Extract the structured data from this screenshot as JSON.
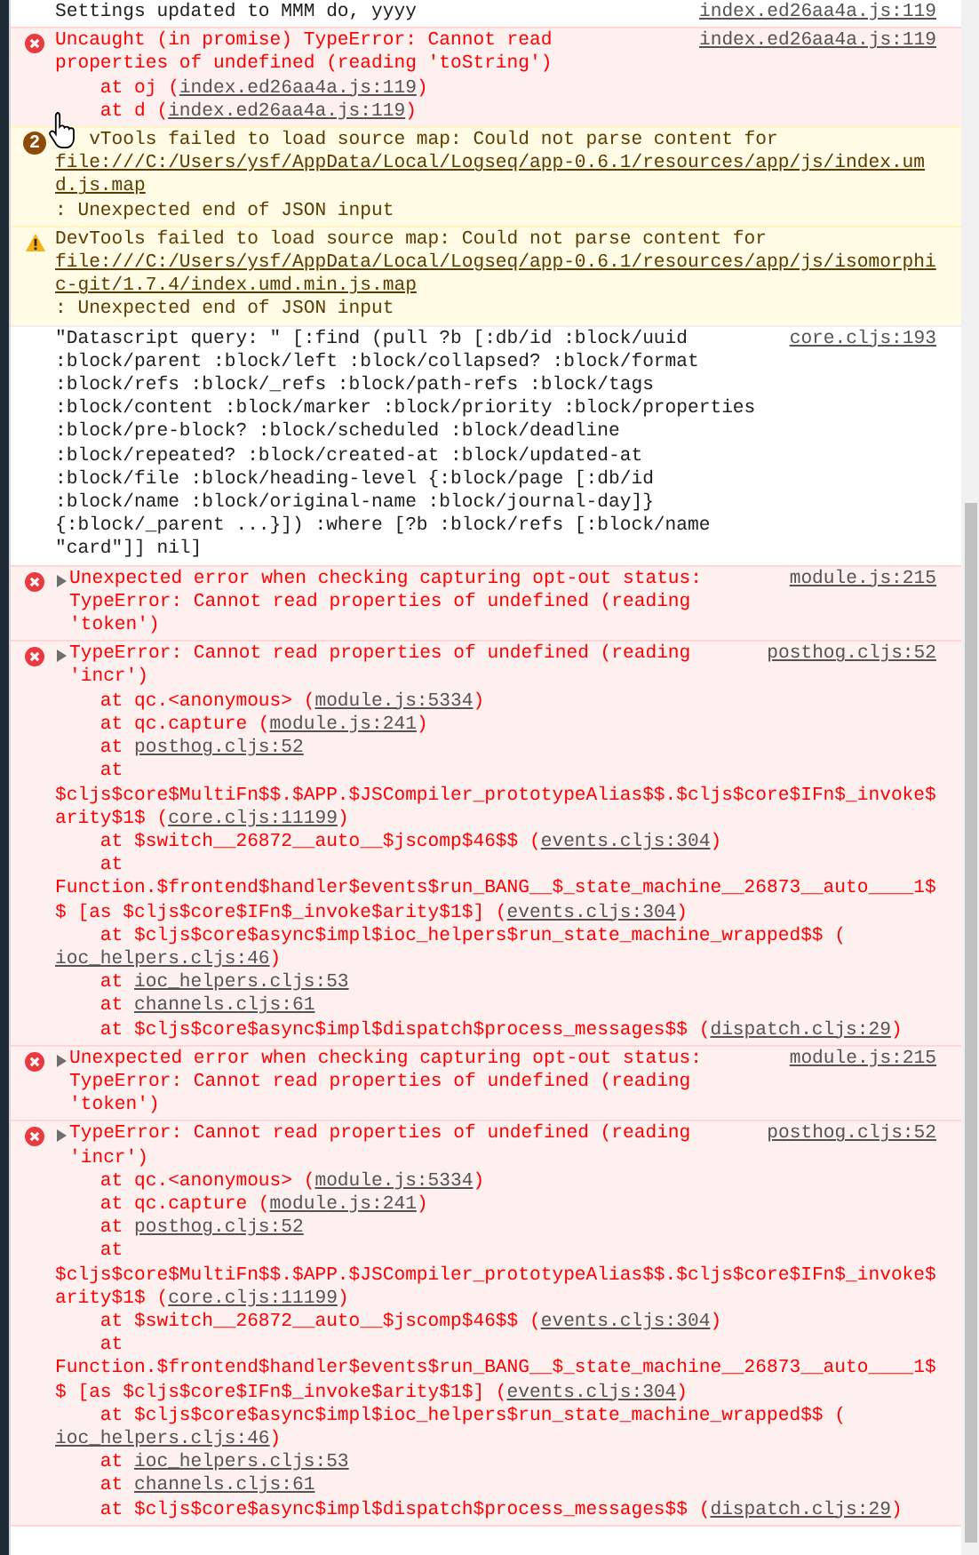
{
  "messages": [
    {
      "kind": "info",
      "parts": [
        {
          "text": "Settings updated to MMM do, yyyy"
        }
      ],
      "source": "index.ed26aa4a.js:119"
    },
    {
      "kind": "error",
      "parts": [
        {
          "text": "Uncaught (in promise) TypeError: Cannot read properties of undefined (reading 'toString')"
        }
      ],
      "source": "index.ed26aa4a.js:119",
      "stack": [
        {
          "parts": [
            {
              "text": "at oj ("
            },
            {
              "link": "index.ed26aa4a.js:119"
            },
            {
              "text": ")"
            }
          ]
        },
        {
          "parts": [
            {
              "text": "at d ("
            },
            {
              "link": "index.ed26aa4a.js:119"
            },
            {
              "text": ")"
            }
          ]
        }
      ]
    },
    {
      "kind": "warning",
      "count": "2",
      "pointer": true,
      "parts": [
        {
          "text": "vTools failed to load source map: Could not parse content for "
        },
        {
          "link": "file:///C:/Users/ysf/AppData/Local/Logseq/app-0.6.1/resources/app/js/index.umd.js.map"
        },
        {
          "text": ": Unexpected end of JSON input"
        }
      ]
    },
    {
      "kind": "warning",
      "parts": [
        {
          "text": "DevTools failed to load source map: Could not parse content for "
        },
        {
          "link": "file:///C:/Users/ysf/AppData/Local/Logseq/app-0.6.1/resources/app/js/isomorphic-git/1.7.4/index.umd.min.js.map"
        },
        {
          "text": ": Unexpected end of JSON input"
        }
      ]
    },
    {
      "kind": "info",
      "parts": [
        {
          "text": "\"Datascript query: \" [:find (pull ?b [:db/id :block/uuid :block/parent :block/left :block/collapsed? :block/format :block/refs :block/_refs :block/path-refs :block/tags :block/content :block/marker :block/priority :block/properties :block/pre-block? :block/scheduled :block/deadline :block/repeated? :block/created-at :block/updated-at :block/file :block/heading-level {:block/page [:db/id :block/name :block/original-name :block/journal-day]} {:block/_parent ...}]) :where [?b :block/refs [:block/name \"card\"]] nil]"
        }
      ],
      "source": "core.cljs:193"
    },
    {
      "kind": "error",
      "expanded": false,
      "parts": [
        {
          "text": "Unexpected error when checking capturing opt-out status: TypeError: Cannot read properties of undefined (reading 'token')"
        }
      ],
      "source": "module.js:215"
    },
    {
      "kind": "error",
      "expanded": false,
      "parts": [
        {
          "text": "TypeError: Cannot read properties of undefined (reading 'incr')"
        }
      ],
      "source": "posthog.cljs:52",
      "stack": [
        {
          "parts": [
            {
              "text": "at qc.<anonymous> ("
            },
            {
              "link": "module.js:5334"
            },
            {
              "text": ")"
            }
          ]
        },
        {
          "parts": [
            {
              "text": "at qc.capture ("
            },
            {
              "link": "module.js:241"
            },
            {
              "text": ")"
            }
          ]
        },
        {
          "parts": [
            {
              "text": "at "
            },
            {
              "link": "posthog.cljs:52"
            }
          ]
        },
        {
          "parts": [
            {
              "text": "at $cljs$core$MultiFn$$.$APP.$JSCompiler_prototypeAlias$$.$cljs$core$IFn$_invoke$arity$1$ ("
            },
            {
              "link": "core.cljs:11199"
            },
            {
              "text": ")"
            }
          ]
        },
        {
          "parts": [
            {
              "text": "at $switch__26872__auto__$jscomp$46$$ ("
            },
            {
              "link": "events.cljs:304"
            },
            {
              "text": ")"
            }
          ]
        },
        {
          "parts": [
            {
              "text": "at Function.$frontend$handler$events$run_BANG__$_state_machine__26873__auto____1$$ [as $cljs$core$IFn$_invoke$arity$1$] ("
            },
            {
              "link": "events.cljs:304"
            },
            {
              "text": ")"
            }
          ]
        },
        {
          "parts": [
            {
              "text": "at $cljs$core$async$impl$ioc_helpers$run_state_machine_wrapped$$ ("
            },
            {
              "link": "ioc_helpers.cljs:46"
            },
            {
              "text": ")"
            }
          ]
        },
        {
          "parts": [
            {
              "text": "at "
            },
            {
              "link": "ioc_helpers.cljs:53"
            }
          ]
        },
        {
          "parts": [
            {
              "text": "at "
            },
            {
              "link": "channels.cljs:61"
            }
          ]
        },
        {
          "parts": [
            {
              "text": "at $cljs$core$async$impl$dispatch$process_messages$$ ("
            },
            {
              "link": "dispatch.cljs:29"
            },
            {
              "text": ")"
            }
          ]
        }
      ]
    },
    {
      "kind": "error",
      "expanded": false,
      "parts": [
        {
          "text": "Unexpected error when checking capturing opt-out status: TypeError: Cannot read properties of undefined (reading 'token')"
        }
      ],
      "source": "module.js:215"
    },
    {
      "kind": "error",
      "expanded": false,
      "parts": [
        {
          "text": "TypeError: Cannot read properties of undefined (reading 'incr')"
        }
      ],
      "source": "posthog.cljs:52",
      "stack": [
        {
          "parts": [
            {
              "text": "at qc.<anonymous> ("
            },
            {
              "link": "module.js:5334"
            },
            {
              "text": ")"
            }
          ]
        },
        {
          "parts": [
            {
              "text": "at qc.capture ("
            },
            {
              "link": "module.js:241"
            },
            {
              "text": ")"
            }
          ]
        },
        {
          "parts": [
            {
              "text": "at "
            },
            {
              "link": "posthog.cljs:52"
            }
          ]
        },
        {
          "parts": [
            {
              "text": "at $cljs$core$MultiFn$$.$APP.$JSCompiler_prototypeAlias$$.$cljs$core$IFn$_invoke$arity$1$ ("
            },
            {
              "link": "core.cljs:11199"
            },
            {
              "text": ")"
            }
          ]
        },
        {
          "parts": [
            {
              "text": "at $switch__26872__auto__$jscomp$46$$ ("
            },
            {
              "link": "events.cljs:304"
            },
            {
              "text": ")"
            }
          ]
        },
        {
          "parts": [
            {
              "text": "at Function.$frontend$handler$events$run_BANG__$_state_machine__26873__auto____1$$ [as $cljs$core$IFn$_invoke$arity$1$] ("
            },
            {
              "link": "events.cljs:304"
            },
            {
              "text": ")"
            }
          ]
        },
        {
          "parts": [
            {
              "text": "at $cljs$core$async$impl$ioc_helpers$run_state_machine_wrapped$$ ("
            },
            {
              "link": "ioc_helpers.cljs:46"
            },
            {
              "text": ")"
            }
          ]
        },
        {
          "parts": [
            {
              "text": "at "
            },
            {
              "link": "ioc_helpers.cljs:53"
            }
          ]
        },
        {
          "parts": [
            {
              "text": "at "
            },
            {
              "link": "channels.cljs:61"
            }
          ]
        },
        {
          "parts": [
            {
              "text": "at $cljs$core$async$impl$dispatch$process_messages$$ ("
            },
            {
              "link": "dispatch.cljs:29"
            },
            {
              "text": ")"
            }
          ]
        }
      ]
    }
  ]
}
